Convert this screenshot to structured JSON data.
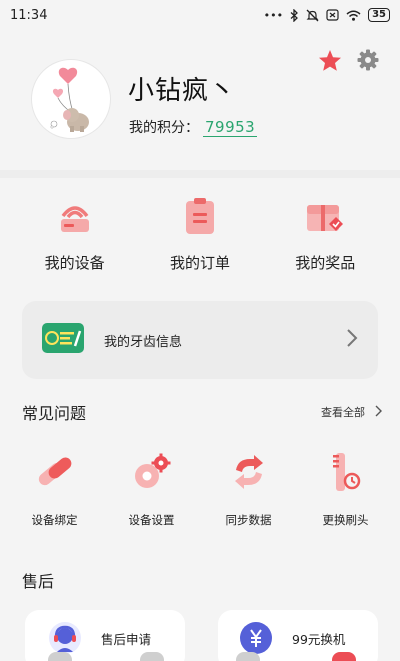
{
  "status_bar": {
    "time": "11:34",
    "battery": "35",
    "icons": [
      "dots-icon",
      "bluetooth-icon",
      "mute-icon",
      "sim-off-icon",
      "wifi-icon",
      "battery-icon"
    ]
  },
  "profile": {
    "nickname": "小钻疯丶",
    "points_label": "我的积分：",
    "points_value": "79953",
    "avatar_icon": "elephant-balloon-avatar",
    "favorite_icon": "star-icon",
    "settings_icon": "gear-icon"
  },
  "quick_actions": [
    {
      "label": "我的设备",
      "icon": "router-icon"
    },
    {
      "label": "我的订单",
      "icon": "clipboard-icon"
    },
    {
      "label": "我的奖品",
      "icon": "gift-box-icon"
    }
  ],
  "teeth_card": {
    "label": "我的牙齿信息",
    "icon": "teeth-chart-icon",
    "arrow_icon": "chevron-right-icon"
  },
  "faq": {
    "title": "常见问题",
    "more_label": "查看全部",
    "items": [
      {
        "label": "设备绑定",
        "icon": "link-icon"
      },
      {
        "label": "设备设置",
        "icon": "settings-gears-icon"
      },
      {
        "label": "同步数据",
        "icon": "sync-icon"
      },
      {
        "label": "更换刷头",
        "icon": "brush-head-icon"
      }
    ]
  },
  "after_sales": {
    "title": "售后",
    "cards": [
      {
        "label": "售后申请",
        "icon": "headset-icon",
        "color": "#5560d8"
      },
      {
        "label": "99元换机",
        "icon": "yuan-icon",
        "color": "#5560d8"
      }
    ]
  },
  "colors": {
    "accent": "#f06a6a",
    "points": "#2aa56f",
    "background": "#f4f4f4"
  }
}
